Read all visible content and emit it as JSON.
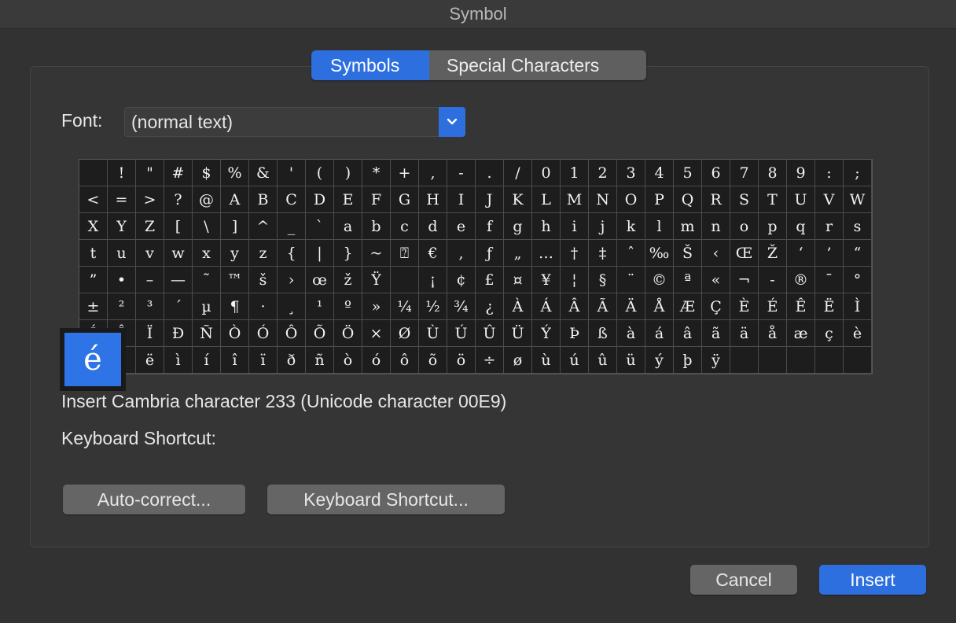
{
  "window": {
    "title": "Symbol"
  },
  "tabs": [
    {
      "label": "Symbols",
      "active": true
    },
    {
      "label": "Special Characters",
      "active": false
    }
  ],
  "font": {
    "label": "Font:",
    "value": "(normal text)",
    "arrow_icon": "chevron-down-icon"
  },
  "grid": {
    "columns": 28,
    "rows": [
      [
        "",
        "!",
        "\"",
        "#",
        "$",
        "%",
        "&",
        "'",
        "(",
        ")",
        "*",
        "+",
        ",",
        "-",
        ".",
        "/",
        "0",
        "1",
        "2",
        "3",
        "4",
        "5",
        "6",
        "7",
        "8",
        "9",
        ":",
        ";"
      ],
      [
        "<",
        "=",
        ">",
        "?",
        "@",
        "A",
        "B",
        "C",
        "D",
        "E",
        "F",
        "G",
        "H",
        "I",
        "J",
        "K",
        "L",
        "M",
        "N",
        "O",
        "P",
        "Q",
        "R",
        "S",
        "T",
        "U",
        "V",
        "W"
      ],
      [
        "X",
        "Y",
        "Z",
        "[",
        "\\",
        "]",
        "^",
        "_",
        "`",
        "a",
        "b",
        "c",
        "d",
        "e",
        "f",
        "g",
        "h",
        "i",
        "j",
        "k",
        "l",
        "m",
        "n",
        "o",
        "p",
        "q",
        "r",
        "s"
      ],
      [
        "t",
        "u",
        "v",
        "w",
        "x",
        "y",
        "z",
        "{",
        "|",
        "}",
        "~",
        "⍰",
        "€",
        ",",
        "ƒ",
        "„",
        "…",
        "†",
        "‡",
        "ˆ",
        "‰",
        "Š",
        "‹",
        "Œ",
        "Ž",
        "‘",
        "’",
        "“"
      ],
      [
        "”",
        "•",
        "–",
        "—",
        "˜",
        "™",
        "š",
        "›",
        "œ",
        "ž",
        "Ÿ",
        "",
        "¡",
        "¢",
        "£",
        "¤",
        "¥",
        "¦",
        "§",
        "¨",
        "©",
        "ª",
        "«",
        "¬",
        "-",
        "®",
        "¯",
        "°"
      ],
      [
        "±",
        "²",
        "³",
        "´",
        "µ",
        "¶",
        "·",
        "¸",
        "¹",
        "º",
        "»",
        "¼",
        "½",
        "¾",
        "¿",
        "À",
        "Á",
        "Â",
        "Ã",
        "Ä",
        "Å",
        "Æ",
        "Ç",
        "È",
        "É",
        "Ê",
        "Ë",
        "Ì"
      ],
      [
        "Í",
        "Î",
        "Ï",
        "Ð",
        "Ñ",
        "Ò",
        "Ó",
        "Ô",
        "Õ",
        "Ö",
        "×",
        "Ø",
        "Ù",
        "Ú",
        "Û",
        "Ü",
        "Ý",
        "Þ",
        "ß",
        "à",
        "á",
        "â",
        "ã",
        "ä",
        "å",
        "æ",
        "ç",
        "è"
      ],
      [
        "é",
        "ê",
        "ë",
        "ì",
        "í",
        "î",
        "ï",
        "ð",
        "ñ",
        "ò",
        "ó",
        "ô",
        "õ",
        "ö",
        "÷",
        "ø",
        "ù",
        "ú",
        "û",
        "ü",
        "ý",
        "þ",
        "ÿ",
        "",
        "",
        "",
        "",
        ""
      ]
    ]
  },
  "selected": {
    "char": "é"
  },
  "info": {
    "description": "Insert Cambria character 233 (Unicode character 00E9)",
    "shortcut_label": "Keyboard Shortcut:"
  },
  "buttons": {
    "autocorrect": "Auto-correct...",
    "keyboard_shortcut": "Keyboard Shortcut...",
    "cancel": "Cancel",
    "insert": "Insert"
  },
  "colors": {
    "accent": "#2e6fe0",
    "background": "#323232",
    "grid_background": "#1d1d1d"
  }
}
